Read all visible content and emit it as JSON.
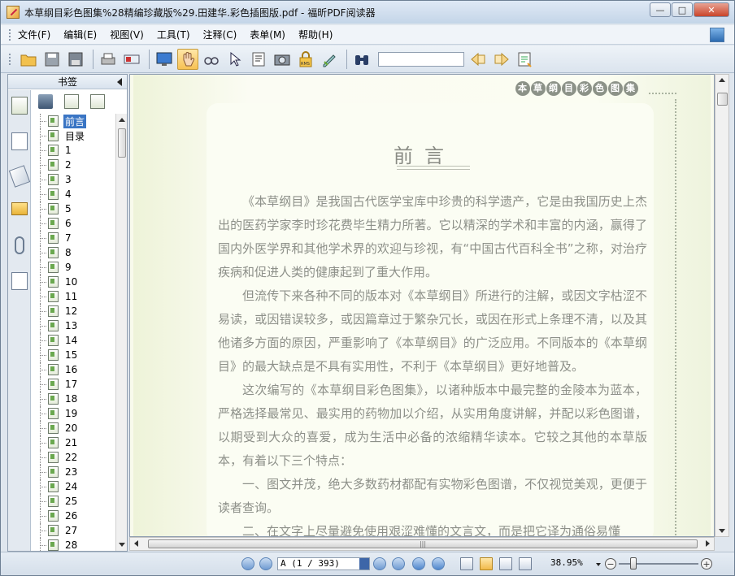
{
  "window": {
    "title": "本草纲目彩色图集%28精编珍藏版%29.田建华.彩色插图版.pdf - 福昕PDF阅读器",
    "minimize_label": "—",
    "restore_label": "□",
    "close_label": "✕"
  },
  "menubar": {
    "items": [
      "文件(F)",
      "编辑(E)",
      "视图(V)",
      "工具(T)",
      "注释(C)",
      "表单(M)",
      "帮助(H)"
    ]
  },
  "toolbar": {
    "search_value": "",
    "icons": [
      "open-folder-icon",
      "save-icon",
      "save-as-icon",
      "print-icon",
      "scan-icon",
      "fullscreen-icon",
      "hand-tool-icon",
      "zoom-glasses-icon",
      "select-arrow-icon",
      "text-select-icon",
      "snapshot-icon",
      "rms-lock-icon",
      "signature-icon",
      "binoculars-search-icon",
      "prev-result-icon",
      "next-result-icon",
      "highlight-icon"
    ],
    "active_tool": "hand-tool-icon",
    "rms_label": "RMS"
  },
  "bookmarks_panel": {
    "title": "书签",
    "selected": "前言",
    "items": [
      "前言",
      "目录",
      "1",
      "2",
      "3",
      "4",
      "5",
      "6",
      "7",
      "8",
      "9",
      "10",
      "11",
      "12",
      "13",
      "14",
      "15",
      "16",
      "17",
      "18",
      "19",
      "20",
      "21",
      "22",
      "23",
      "24",
      "25",
      "26",
      "27",
      "28"
    ]
  },
  "document": {
    "header_deco": [
      "本",
      "草",
      "纲",
      "目",
      "彩",
      "色",
      "图",
      "集"
    ],
    "heading": "前言",
    "paragraphs": [
      "《本草纲目》是我国古代医学宝库中珍贵的科学遗产，它是由我国历史上杰出的医药学家李时珍花费毕生精力所著。它以精深的学术和丰富的内涵，赢得了国内外医学界和其他学术界的欢迎与珍视，有“中国古代百科全书”之称，对治疗疾病和促进人类的健康起到了重大作用。",
      "但流传下来各种不同的版本对《本草纲目》所进行的注解，或因文字枯涩不易读，或因错误较多，或因篇章过于繁杂冗长，或因在形式上条理不清，以及其他诸多方面的原因，严重影响了《本草纲目》的广泛应用。不同版本的《本草纲目》的最大缺点是不具有实用性，不利于《本草纲目》更好地普及。",
      "这次编写的《本草纲目彩色图集》，以诸种版本中最完整的金陵本为蓝本，严格选择最常见、最实用的药物加以介绍，从实用角度讲解，并配以彩色图谱，以期受到大众的喜爱，成为生活中必备的浓缩精华读本。它较之其他的本草版本，有着以下三个特点：",
      "一、图文并茂，绝大多数药材都配有实物彩色图谱，不仅视觉美观，更便于读者查询。",
      "二、在文字上尽量避免使用艰涩难懂的文言文，而是把它译为通俗易懂"
    ]
  },
  "statusbar": {
    "page_field": "A (1 / 393)",
    "zoom": "38.95%",
    "zoom_level": 0.3895
  },
  "colors": {
    "selection": "#3a75c4",
    "page_bg": "#fbfdf2",
    "text_gray": "#8d9089"
  }
}
